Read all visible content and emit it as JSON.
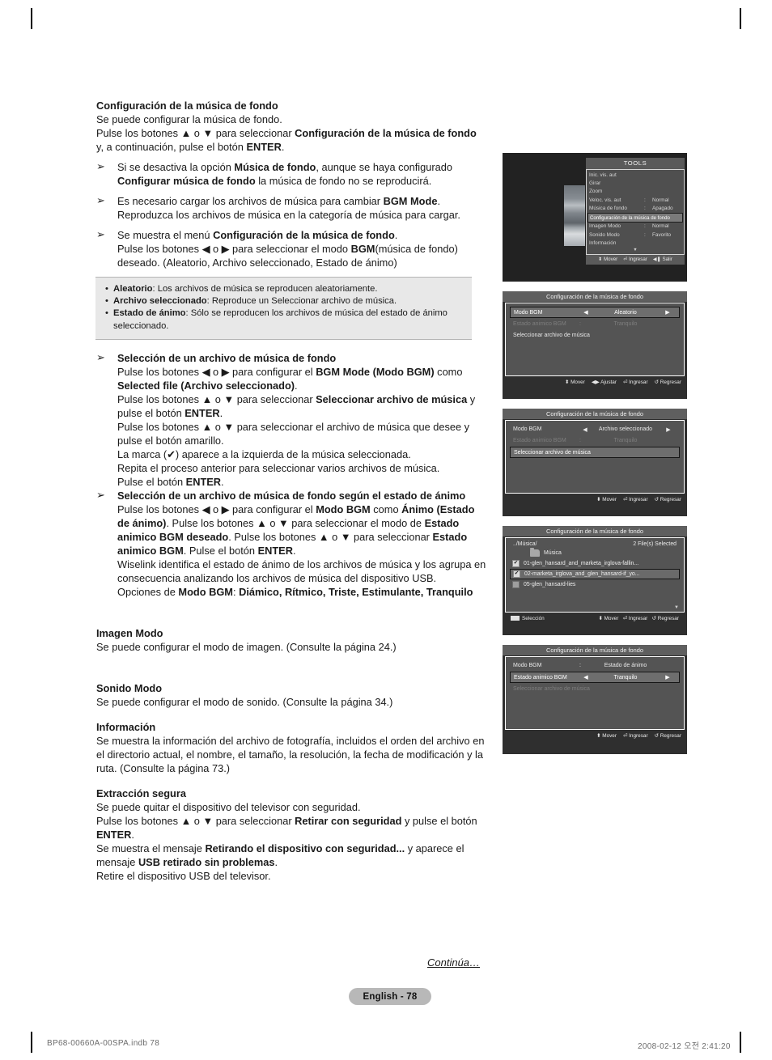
{
  "document": {
    "heading": "Configuración de la música de fondo",
    "intro_lines": [
      "Se puede configurar la música de fondo.",
      "Pulse los botones ▲ o ▼ para seleccionar Configuración de la música de fondo y, a continuación, pulse el botón ENTER."
    ],
    "intro_line1": "Se puede configurar la música de fondo.",
    "intro_line2_a": "Pulse los botones ▲ o ▼ para seleccionar ",
    "intro_line2_b": "Configuración de la música de fondo",
    "intro_line2_c": " y, a continuación, pulse el botón ",
    "intro_line2_d": "ENTER",
    "intro_line2_e": ".",
    "bullet1": {
      "a": "Si se desactiva la opción ",
      "b": "Música de fondo",
      "c": ", aunque se haya configurado ",
      "d": "Configurar música de fondo",
      "e": " la música de fondo no se reproducirá."
    },
    "bullet2": {
      "a": "Es necesario cargar los archivos de música para cambiar ",
      "b": "BGM Mode",
      "c": ". Reproduzca los archivos de música en la categoría de música para cargar."
    },
    "bullet3": {
      "a": "Se muestra el menú ",
      "b": "Configuración de la música de fondo",
      "c": ".",
      "d": "Pulse los botones ◀ o ▶ para seleccionar el modo ",
      "e": "BGM",
      "f": "(música de fondo) deseado. (Aleatorio, Archivo seleccionado, Estado de ánimo)"
    },
    "info_box": {
      "item1_term": "Aleatorio",
      "item1_text": ": Los archivos de música se reproducen aleatoriamente.",
      "item2_term": "Archivo seleccionado",
      "item2_text": ": Reproduce un Seleccionar archivo de música.",
      "item3_term": "Estado de ánimo",
      "item3_text": ": Sólo se reproducen los archivos de música del estado de ánimo seleccionado."
    },
    "bullet4": {
      "title": "Selección de un archivo de música de fondo",
      "l1a": "Pulse los botones ◀ o ▶ para configurar el ",
      "l1b": "BGM Mode (Modo BGM)",
      "l1c": " como ",
      "l1d": "Selected file (Archivo seleccionado)",
      "l1e": ".",
      "l2a": "Pulse los botones ▲ o ▼ para seleccionar ",
      "l2b": "Seleccionar archivo de música",
      "l2c": " y pulse el botón ",
      "l2d": "ENTER",
      "l2e": ".",
      "l3": "Pulse los botones ▲ o ▼ para seleccionar el archivo de música que desee y pulse el botón amarillo.",
      "l4": "La marca (✔) aparece a la izquierda de la música seleccionada.",
      "l5": "Repita el proceso anterior para seleccionar varios archivos de música.",
      "l6a": "Pulse el botón ",
      "l6b": "ENTER",
      "l6c": "."
    },
    "bullet5": {
      "title": "Selección de un archivo de música de fondo según el estado de ánimo",
      "l1a": "Pulse los botones ◀ o ▶ para configurar el ",
      "l1b": "Modo BGM",
      "l1c": " como ",
      "l1d": "Ánimo (Estado de ánimo)",
      "l1e": ". Pulse los botones ▲ o ▼ para seleccionar el modo de ",
      "l1f": "Estado animico BGM deseado",
      "l1g": ". Pulse los botones ▲ o ▼ para seleccionar ",
      "l1h": "Estado animico BGM",
      "l1i": ". Pulse el botón ",
      "l1j": "ENTER",
      "l1k": ".",
      "l2": "Wiselink identifica el estado de ánimo de los archivos de música y los agrupa en consecuencia analizando los archivos de música del dispositivo USB.",
      "l3a": "Opciones de ",
      "l3b": "Modo BGM",
      "l3c": ": ",
      "l3d": "Diámico, Rítmico, Triste, Estimulante, Tranquilo"
    },
    "section_imagen": {
      "title": "Imagen Modo",
      "text": "Se puede configurar el modo de imagen. (Consulte la página 24.)"
    },
    "section_sonido": {
      "title": "Sonido Modo",
      "text": "Se puede configurar el modo de sonido. (Consulte la página 34.)"
    },
    "section_informacion": {
      "title": "Información",
      "text": "Se muestra la información del archivo de fotografía, incluidos el orden del archivo en el directorio actual, el nombre, el tamaño, la resolución, la fecha de modificación y la ruta. (Consulte la página 73.)"
    },
    "section_extraccion": {
      "title": "Extracción segura",
      "l1": "Se puede quitar el dispositivo del televisor con seguridad.",
      "l2a": "Pulse los botones ▲ o ▼ para seleccionar ",
      "l2b": "Retirar con seguridad",
      "l2c": " y pulse el botón ",
      "l2d": "ENTER",
      "l2e": ".",
      "l3a": "Se muestra el mensaje ",
      "l3b": "Retirando el dispositivo con seguridad...",
      "l3c": " y aparece el mensaje ",
      "l3d": "USB retirado sin problemas",
      "l3e": ".",
      "l4": "Retire el dispositivo USB del televisor."
    },
    "continua": "Continúa…",
    "page_label": "English - 78",
    "footer_left": "BP68-00660A-00SPA.indb   78",
    "footer_right": "2008-02-12   오전 2:41:20"
  },
  "panels": {
    "tools": {
      "title": "TOOLS",
      "rows": [
        {
          "label": "Inic. vis. aut",
          "colon": "",
          "value": ""
        },
        {
          "label": "Girar",
          "colon": "",
          "value": ""
        },
        {
          "label": "Zoom",
          "colon": "",
          "value": ""
        },
        {
          "label": "Veloc. vis. aut",
          "colon": ":",
          "value": "Normal"
        },
        {
          "label": "Música de fondo",
          "colon": ":",
          "value": "Apagado"
        }
      ],
      "highlight_row": "Configuración de la música de fondo",
      "rows_after": [
        {
          "label": "Imagen Modo",
          "colon": ":",
          "value": "Normal"
        },
        {
          "label": "Sonido Modo",
          "colon": ":",
          "value": "Favorito"
        },
        {
          "label": "Información",
          "colon": "",
          "value": ""
        }
      ],
      "scroll_glyph": "▼",
      "footer": [
        "⬍ Mover",
        "⏎ Ingresar",
        "◀❚ Salir"
      ]
    },
    "random": {
      "title": "Configuración de la música de fondo",
      "row_mode_label": "Modo BGM",
      "row_mode_arrow_left": "◀",
      "row_mode_value": "Aleatorio",
      "row_mode_arrow_right": "▶",
      "row_mood_label": "Estado animico BGM",
      "row_mood_colon": ":",
      "row_mood_value": "Tranquilo",
      "row_file_label": "Seleccionar archivo de música",
      "footer": [
        "⬍ Mover",
        "◀▶ Ajustar",
        "⏎ Ingresar",
        "↺ Regresar"
      ]
    },
    "selfile": {
      "title": "Configuración de la música de fondo",
      "row_mode_label": "Modo BGM",
      "row_mode_arrow_left": "◀",
      "row_mode_value": "Archivo seleccionado",
      "row_mode_arrow_right": "▶",
      "row_mood_label": "Estado animico BGM",
      "row_mood_colon": ":",
      "row_mood_value": "Tranquilo",
      "row_file_label": "Seleccionar archivo de música",
      "footer": [
        "⬍ Mover",
        "⏎ Ingresar",
        "↺ Regresar"
      ]
    },
    "filelist": {
      "title": "Configuración de la música de fondo",
      "path": "../Música/",
      "count": "2 File(s) Selected",
      "folder_name": "Música",
      "files": [
        {
          "checked": "✔",
          "name": "01-glen_hansard_and_marketa_irglova-fallin..."
        },
        {
          "checked": "✔",
          "name": "02-marketa_irglova_and_glen_hansard-if_yo..."
        },
        {
          "checked": "",
          "name": "05-glen_hansard-lies"
        }
      ],
      "scroll_glyph": "▼",
      "footer_selection": "Selección",
      "footer": [
        "⬍ Mover",
        "⏎ Ingresar",
        "↺ Regresar"
      ]
    },
    "mood": {
      "title": "Configuración de la música de fondo",
      "row_mode_label": "Modo BGM",
      "row_mode_colon": ":",
      "row_mode_value": "Estado de ánimo",
      "row_mood_label": "Estado animico BGM",
      "row_mood_arrow_left": "◀",
      "row_mood_value": "Tranquilo",
      "row_mood_arrow_right": "▶",
      "row_file_label": "Seleccionar archivo de música",
      "footer": [
        "⬍ Mover",
        "⏎ Ingresar",
        "↺ Regresar"
      ]
    }
  }
}
